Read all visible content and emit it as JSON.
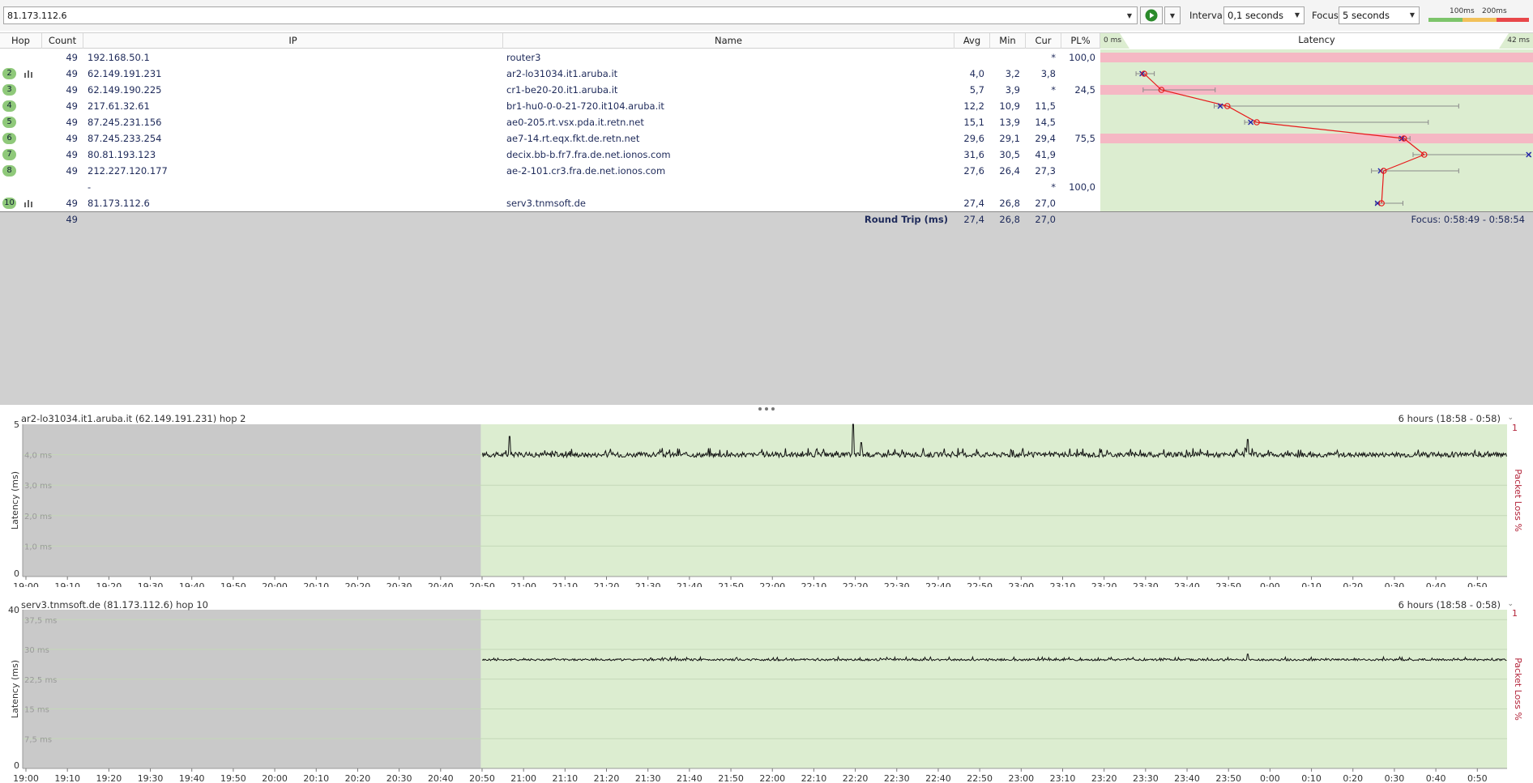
{
  "toolbar": {
    "target": "81.173.112.6",
    "interval_label": "Interval",
    "interval_value": "0,1 seconds",
    "focus_label": "Focus",
    "focus_value": "5 seconds",
    "legend_100": "100ms",
    "legend_200": "200ms"
  },
  "table": {
    "headers": {
      "hop": "Hop",
      "count": "Count",
      "ip": "IP",
      "name": "Name",
      "avg": "Avg",
      "min": "Min",
      "cur": "Cur",
      "pl": "PL%",
      "latency": "Latency"
    },
    "latency_min_label": "0 ms",
    "latency_max_label": "42 ms",
    "latency_scale_max": 42,
    "rows": [
      {
        "hop": "",
        "count": "49",
        "ip": "192.168.50.1",
        "name": "router3",
        "avg": "",
        "min": "",
        "cur": "*",
        "pl": "100,0",
        "loss": true,
        "has_graph": false,
        "avg_v": null,
        "min_v": null,
        "cur_v": null,
        "max_v": null
      },
      {
        "hop": "2",
        "count": "49",
        "ip": "62.149.191.231",
        "name": "ar2-lo31034.it1.aruba.it",
        "avg": "4,0",
        "min": "3,2",
        "cur": "3,8",
        "pl": "",
        "loss": false,
        "has_graph": true,
        "avg_v": 4.0,
        "min_v": 3.2,
        "cur_v": 3.8,
        "max_v": 5.0
      },
      {
        "hop": "3",
        "count": "49",
        "ip": "62.149.190.225",
        "name": "cr1-be20-20.it1.aruba.it",
        "avg": "5,7",
        "min": "3,9",
        "cur": "*",
        "pl": "24,5",
        "loss": true,
        "has_graph": false,
        "avg_v": 5.7,
        "min_v": 3.9,
        "cur_v": null,
        "max_v": 11.0
      },
      {
        "hop": "4",
        "count": "49",
        "ip": "217.61.32.61",
        "name": "br1-hu0-0-0-21-720.it104.aruba.it",
        "avg": "12,2",
        "min": "10,9",
        "cur": "11,5",
        "pl": "",
        "loss": false,
        "has_graph": false,
        "avg_v": 12.2,
        "min_v": 10.9,
        "cur_v": 11.5,
        "max_v": 35.0
      },
      {
        "hop": "5",
        "count": "49",
        "ip": "87.245.231.156",
        "name": "ae0-205.rt.vsx.pda.it.retn.net",
        "avg": "15,1",
        "min": "13,9",
        "cur": "14,5",
        "pl": "",
        "loss": false,
        "has_graph": false,
        "avg_v": 15.1,
        "min_v": 13.9,
        "cur_v": 14.5,
        "max_v": 32.0
      },
      {
        "hop": "6",
        "count": "49",
        "ip": "87.245.233.254",
        "name": "ae7-14.rt.eqx.fkt.de.retn.net",
        "avg": "29,6",
        "min": "29,1",
        "cur": "29,4",
        "pl": "75,5",
        "loss": true,
        "has_graph": false,
        "avg_v": 29.6,
        "min_v": 29.1,
        "cur_v": 29.4,
        "max_v": 30.2
      },
      {
        "hop": "7",
        "count": "49",
        "ip": "80.81.193.123",
        "name": "decix.bb-b.fr7.fra.de.net.ionos.com",
        "avg": "31,6",
        "min": "30,5",
        "cur": "41,9",
        "pl": "",
        "loss": false,
        "has_graph": false,
        "avg_v": 31.6,
        "min_v": 30.5,
        "cur_v": 41.9,
        "max_v": 42.0
      },
      {
        "hop": "8",
        "count": "49",
        "ip": "212.227.120.177",
        "name": "ae-2-101.cr3.fra.de.net.ionos.com",
        "avg": "27,6",
        "min": "26,4",
        "cur": "27,3",
        "pl": "",
        "loss": false,
        "has_graph": false,
        "avg_v": 27.6,
        "min_v": 26.4,
        "cur_v": 27.3,
        "max_v": 35.0
      },
      {
        "hop": "",
        "count": "",
        "ip": "-",
        "name": "",
        "avg": "",
        "min": "",
        "cur": "*",
        "pl": "100,0",
        "loss": false,
        "has_graph": false,
        "avg_v": null,
        "min_v": null,
        "cur_v": null,
        "max_v": null
      },
      {
        "hop": "10",
        "count": "49",
        "ip": "81.173.112.6",
        "name": "serv3.tnmsoft.de",
        "avg": "27,4",
        "min": "26,8",
        "cur": "27,0",
        "pl": "",
        "loss": false,
        "has_graph": true,
        "avg_v": 27.4,
        "min_v": 26.8,
        "cur_v": 27.0,
        "max_v": 29.5
      }
    ],
    "round_trip": {
      "count": "49",
      "label": "Round Trip (ms)",
      "avg": "27,4",
      "min": "26,8",
      "cur": "27,0",
      "focus": "Focus: 0:58:49 - 0:58:54"
    }
  },
  "charts": [
    {
      "title": "ar2-lo31034.it1.aruba.it (62.149.191.231) hop 2",
      "range": "6 hours (18:58 - 0:58)",
      "ylabel": "Latency (ms)",
      "y2label": "Packet Loss %",
      "y_top": "5",
      "y_bottom": "0",
      "y2_top": "1",
      "ymax": 5,
      "grid": [
        {
          "v": 4.0,
          "label": "4,0 ms"
        },
        {
          "v": 3.0,
          "label": "3,0 ms"
        },
        {
          "v": 2.0,
          "label": "2,0 ms"
        },
        {
          "v": 1.0,
          "label": "1,0 ms"
        }
      ],
      "baseline": 4.0,
      "noise": 0.08,
      "spikes": [
        {
          "t": 0.028,
          "v": 4.6
        },
        {
          "t": 0.363,
          "v": 5.0
        },
        {
          "t": 0.371,
          "v": 4.4
        },
        {
          "t": 0.747,
          "v": 4.5
        }
      ]
    },
    {
      "title": "serv3.tnmsoft.de (81.173.112.6) hop 10",
      "range": "6 hours (18:58 - 0:58)",
      "ylabel": "Latency (ms)",
      "y2label": "Packet Loss %",
      "y_top": "40",
      "y_bottom": "0",
      "y2_top": "1",
      "ymax": 40,
      "grid": [
        {
          "v": 37.5,
          "label": "37,5 ms"
        },
        {
          "v": 30,
          "label": "30 ms"
        },
        {
          "v": 22.5,
          "label": "22,5 ms"
        },
        {
          "v": 15,
          "label": "15 ms"
        },
        {
          "v": 7.5,
          "label": "7,5 ms"
        }
      ],
      "baseline": 27.4,
      "noise": 0.25,
      "spikes": [
        {
          "t": 0.747,
          "v": 28.8
        }
      ]
    }
  ],
  "time_ticks": [
    "19:00",
    "19:10",
    "19:20",
    "19:30",
    "19:40",
    "19:50",
    "20:00",
    "20:10",
    "20:20",
    "20:30",
    "20:40",
    "20:50",
    "21:00",
    "21:10",
    "21:20",
    "21:30",
    "21:40",
    "21:50",
    "22:00",
    "22:10",
    "22:20",
    "22:30",
    "22:40",
    "22:50",
    "23:00",
    "23:10",
    "23:20",
    "23:30",
    "23:40",
    "23:50",
    "0:00",
    "0:10",
    "0:20",
    "0:30",
    "0:40",
    "0:50"
  ],
  "colors": {
    "plot_green": "#dcedd0",
    "loss_red": "#f5b8c4",
    "no_data_gray": "#c9c9c9",
    "line_red": "#e8191a",
    "marker_blue": "#2222aa"
  }
}
